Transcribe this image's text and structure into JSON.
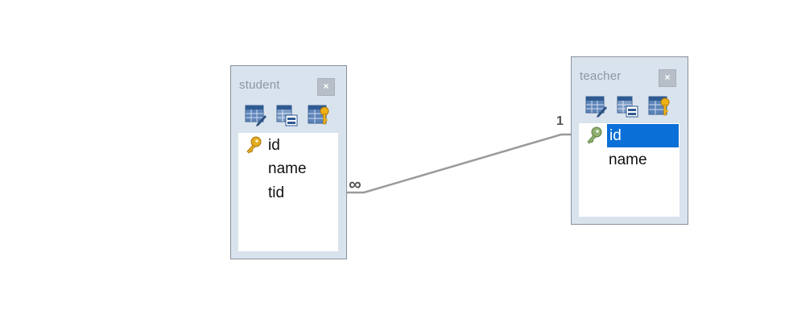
{
  "tables": [
    {
      "key": "student",
      "title": "student",
      "close_label": "×",
      "tools": [
        "table-edit-icon",
        "table-design-icon",
        "table-key-icon"
      ],
      "fields": [
        {
          "name": "id",
          "primary_key": true,
          "selected": false
        },
        {
          "name": "name",
          "primary_key": false,
          "selected": false
        },
        {
          "name": "tid",
          "primary_key": false,
          "selected": false
        }
      ]
    },
    {
      "key": "teacher",
      "title": "teacher",
      "close_label": "×",
      "tools": [
        "table-edit-icon",
        "table-design-icon",
        "table-key-icon"
      ],
      "fields": [
        {
          "name": "id",
          "primary_key": true,
          "selected": true
        },
        {
          "name": "name",
          "primary_key": false,
          "selected": false
        }
      ]
    }
  ],
  "relationship": {
    "from_table": "student",
    "from_field": "tid",
    "to_table": "teacher",
    "to_field": "id",
    "from_cardinality": "∞",
    "to_cardinality": "1"
  },
  "colors": {
    "selection": "#0a6fd6",
    "primary_key_gold": "#d9a520",
    "primary_key_green": "#7aa05a",
    "link_line": "#9a9a9a"
  }
}
